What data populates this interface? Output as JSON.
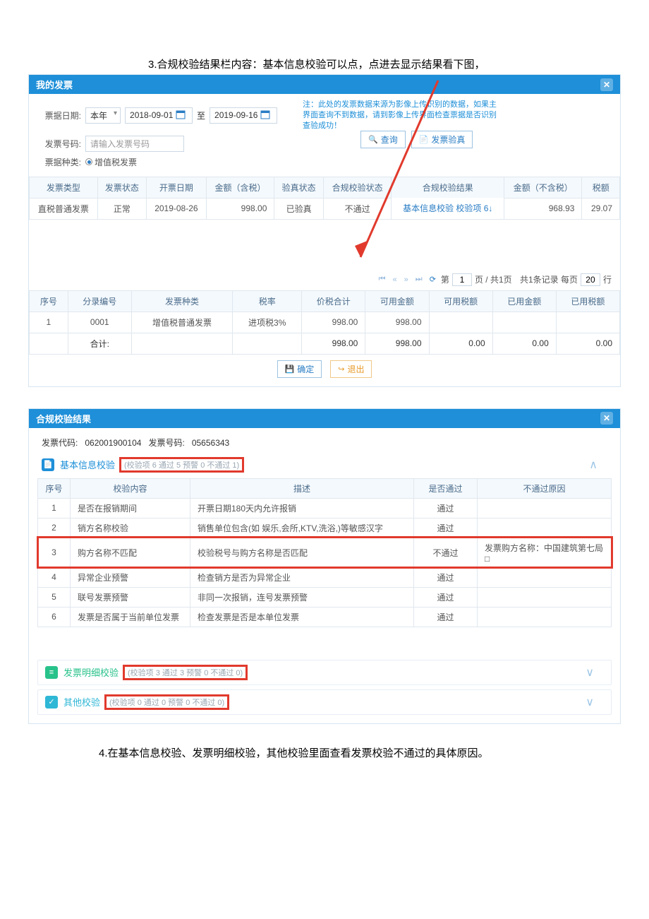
{
  "caption_top": "3.合规校验结果栏内容：基本信息校验可以点，点进去显示结果看下图，",
  "caption_bottom": "4.在基本信息校验、发票明细校验，其他校验里面查看发票校验不通过的具体原因。",
  "panel1": {
    "title": "我的发票",
    "filters": {
      "date_lbl": "票据日期:",
      "year_sel": "本年",
      "date_from": "2018-09-01",
      "to_lbl": "至",
      "date_to": "2019-09-16",
      "no_lbl": "发票号码:",
      "no_ph": "请输入发票号码",
      "type_lbl": "票据种类:",
      "type_radio": "增值税发票",
      "note": "注：此处的发票数据来源为影像上传识别的数据，如果主界面查询不到数据，请到影像上传界面检查票据是否识别查验成功！",
      "btn_query": "查询",
      "btn_verify": "发票验真"
    },
    "cols": [
      "发票类型",
      "发票状态",
      "开票日期",
      "金额（含税）",
      "验真状态",
      "合规校验状态",
      "合规校验结果",
      "金额（不含税）",
      "税额"
    ],
    "row": {
      "c0": "直税普通发票",
      "c1": "正常",
      "c2": "2019-08-26",
      "c3": "998.00",
      "c4": "已验真",
      "c5": "不通过",
      "c6": "基本信息校验 校验项 6↓",
      "c7": "968.93",
      "c8": "29.07"
    },
    "pager": {
      "cur": "1",
      "pages_lbl": "页 / 共1页",
      "total_lbl": "共1条记录 每页",
      "size": "20",
      "rows_lbl": "行",
      "first": "⏮",
      "prev": "«",
      "next": "»",
      "last": "⏭",
      "refresh": "⟳",
      "page_lbl": "第"
    },
    "sub_cols": [
      "序号",
      "分录编号",
      "发票种类",
      "税率",
      "价税合计",
      "可用金额",
      "可用税额",
      "已用金额",
      "已用税额"
    ],
    "sub_row": {
      "c0": "1",
      "c1": "0001",
      "c2": "增值税普通发票",
      "c3": "进项税3%",
      "c4": "998.00",
      "c5": "998.00",
      "c6": "",
      "c7": "",
      "c8": ""
    },
    "total": {
      "lbl": "合计:",
      "c4": "998.00",
      "c5": "998.00",
      "c6": "0.00",
      "c7": "0.00",
      "c8": "0.00"
    },
    "btn_ok": "确定",
    "btn_exit": "退出"
  },
  "panel2": {
    "title": "合规校验结果",
    "info": {
      "code_lbl": "发票代码:",
      "code": "062001900104",
      "no_lbl": "发票号码:",
      "no": "05656343"
    },
    "sec1": {
      "title": "基本信息校验",
      "sub": "(校验项 6 通过 5 预警 0 不通过 1)"
    },
    "check_cols": [
      "序号",
      "校验内容",
      "描述",
      "是否通过",
      "不通过原因"
    ],
    "check_rows": [
      {
        "n": "1",
        "a": "是否在报销期间",
        "b": "开票日期180天内允许报销",
        "c": "通过",
        "d": ""
      },
      {
        "n": "2",
        "a": "销方名称校验",
        "b": "销售单位包含(如 娱乐,会所,KTV,洗浴,)等敏感汉字",
        "c": "通过",
        "d": ""
      },
      {
        "n": "3",
        "a": "购方名称不匹配",
        "b": "校验税号与购方名称是否匹配",
        "c": "不通过",
        "d": "发票购方名称：中国建筑第七局□"
      },
      {
        "n": "4",
        "a": "异常企业预警",
        "b": "检查销方是否为异常企业",
        "c": "通过",
        "d": ""
      },
      {
        "n": "5",
        "a": "联号发票预警",
        "b": "非同一次报销，连号发票预警",
        "c": "通过",
        "d": ""
      },
      {
        "n": "6",
        "a": "发票是否属于当前单位发票",
        "b": "检查发票是否是本单位发票",
        "c": "通过",
        "d": ""
      }
    ],
    "sec2": {
      "title": "发票明细校验",
      "sub": "(校验项 3 通过 3 预警 0 不通过 0)"
    },
    "sec3": {
      "title": "其他校验",
      "sub": "(校验项 0 通过 0 预警 0 不通过 0)"
    }
  }
}
